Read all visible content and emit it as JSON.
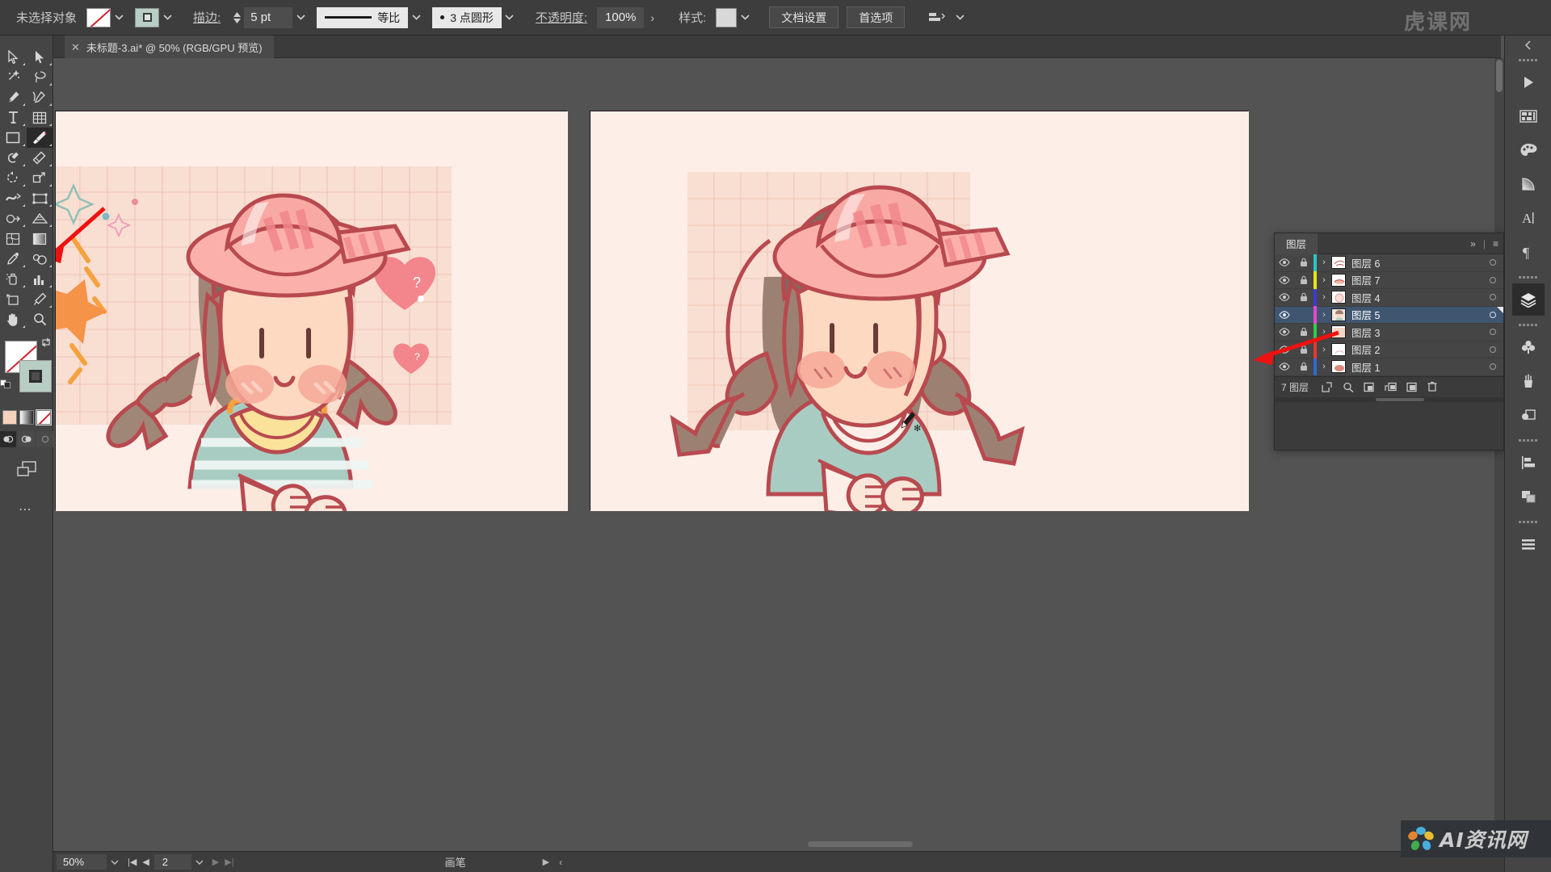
{
  "app": {
    "name": "Adobe Illustrator",
    "selection_status": "未选择对象"
  },
  "control_bar": {
    "fill_label": "fill-swatch",
    "stroke_label": "stroke-swatch",
    "stroke_text": "描边:",
    "stroke_weight": "5 pt",
    "stroke_profile": "等比",
    "brush_definition": "3 点圆形",
    "opacity_text": "不透明度:",
    "opacity_value": "100%",
    "style_text": "样式:",
    "document_setup": "文档设置",
    "preferences": "首选项",
    "align_icon": "align-icon"
  },
  "tab_bar": {
    "close_glyph": "✕",
    "document_title": "未标题-3.ai* @ 50% (RGB/GPU 预览)"
  },
  "left_toolbar": {
    "tools": [
      {
        "name": "selection-tool",
        "glyph": "select"
      },
      {
        "name": "direct-selection-tool",
        "glyph": "direct-select"
      },
      {
        "name": "magic-wand-tool",
        "glyph": "wand"
      },
      {
        "name": "lasso-tool",
        "glyph": "lasso"
      },
      {
        "name": "pen-tool",
        "glyph": "pen"
      },
      {
        "name": "curvature-tool",
        "glyph": "curvature"
      },
      {
        "name": "type-tool",
        "glyph": "type"
      },
      {
        "name": "table-tool",
        "glyph": "table"
      },
      {
        "name": "rectangle-tool",
        "glyph": "rect"
      },
      {
        "name": "paintbrush-tool",
        "glyph": "brush"
      },
      {
        "name": "shaper-tool",
        "glyph": "shaper"
      },
      {
        "name": "eraser-tool",
        "glyph": "eraser"
      },
      {
        "name": "rotate-tool",
        "glyph": "rotate"
      },
      {
        "name": "scale-tool",
        "glyph": "scale"
      },
      {
        "name": "width-tool",
        "glyph": "width"
      },
      {
        "name": "free-transform-tool",
        "glyph": "freetransform"
      },
      {
        "name": "shape-builder-tool",
        "glyph": "shapebuilder"
      },
      {
        "name": "perspective-grid-tool",
        "glyph": "perspective"
      },
      {
        "name": "mesh-tool",
        "glyph": "mesh"
      },
      {
        "name": "gradient-tool",
        "glyph": "gradient"
      },
      {
        "name": "eyedropper-tool",
        "glyph": "eyedropper"
      },
      {
        "name": "blend-tool",
        "glyph": "blend"
      },
      {
        "name": "symbol-sprayer-tool",
        "glyph": "sprayer"
      },
      {
        "name": "column-graph-tool",
        "glyph": "graph"
      },
      {
        "name": "artboard-tool",
        "glyph": "artboard"
      },
      {
        "name": "slice-tool",
        "glyph": "slice"
      },
      {
        "name": "hand-tool",
        "glyph": "hand"
      },
      {
        "name": "zoom-tool",
        "glyph": "zoom"
      }
    ],
    "selected_tool": "paintbrush-tool",
    "fill_color": "#ffffff",
    "fill_is_none": true,
    "stroke_color": "#b8cdc4",
    "mini_swatches": [
      "#f6d2bd",
      "gradient",
      "none"
    ],
    "draw_modes": [
      "draw-normal",
      "draw-behind",
      "draw-inside"
    ],
    "more_tools": "⋯"
  },
  "layers_panel": {
    "title": "图层",
    "collapse_glyph": "»",
    "menu_glyph": "≡",
    "rows": [
      {
        "name": "图层 6",
        "color": "#2ec6c6",
        "visible": true,
        "locked": true,
        "selected": false,
        "thumb": "#f3ded6"
      },
      {
        "name": "图层 7",
        "color": "#e8e413",
        "visible": true,
        "locked": true,
        "selected": false,
        "thumb": "#f6e0d8"
      },
      {
        "name": "图层 4",
        "color": "#3b3bd6",
        "visible": true,
        "locked": true,
        "selected": false,
        "thumb": "#fae6e0"
      },
      {
        "name": "图层 5",
        "color": "#e846c8",
        "visible": true,
        "locked": false,
        "selected": true,
        "thumb": "#e9c3a8"
      },
      {
        "name": "图层 3",
        "color": "#2ecc4a",
        "visible": true,
        "locked": true,
        "selected": false,
        "thumb": "#f6d8c8"
      },
      {
        "name": "图层 2",
        "color": "#e33b2e",
        "visible": true,
        "locked": true,
        "selected": false,
        "thumb": "#ffffff"
      },
      {
        "name": "图层 1",
        "color": "#2e6ad6",
        "visible": true,
        "locked": true,
        "selected": false,
        "thumb": "#f3d9cf"
      }
    ],
    "footer_count": "7 图层",
    "footer_icons": [
      "locate-object-icon",
      "search-icon",
      "make-clipping-mask-icon",
      "create-sublayer-icon",
      "create-new-layer-icon",
      "delete-layer-icon"
    ]
  },
  "right_dock": {
    "groups": [
      {
        "items": [
          {
            "name": "properties-panel-icon"
          },
          {
            "name": "libraries-panel-icon"
          },
          {
            "name": "color-panel-icon"
          },
          {
            "name": "gradient-panel-icon"
          },
          {
            "name": "character-panel-icon"
          },
          {
            "name": "paragraph-panel-icon"
          }
        ]
      },
      {
        "items": [
          {
            "name": "layers-panel-icon",
            "selected": true
          }
        ]
      },
      {
        "items": [
          {
            "name": "symbols-panel-icon"
          },
          {
            "name": "brushes-panel-icon"
          },
          {
            "name": "transparency-panel-icon"
          }
        ]
      },
      {
        "items": [
          {
            "name": "align-panel-icon"
          },
          {
            "name": "pathfinder-panel-icon"
          }
        ]
      },
      {
        "items": [
          {
            "name": "stroke-panel-icon"
          }
        ]
      }
    ]
  },
  "status_bar": {
    "zoom": "50%",
    "page": "2",
    "tool_name": "画笔",
    "first_glyph": "|◀",
    "prev_glyph": "◀",
    "next_glyph": "▶",
    "last_glyph": "▶|",
    "expand_glyph": "▶",
    "collapse_glyph": "‹"
  },
  "watermarks": {
    "top_right": "虎课网",
    "bottom_right": "AI资讯网"
  },
  "artboards": [
    {
      "id": "artboard-left",
      "background": "#fdeee8",
      "description": "卡通女孩插画 - 带草帽、双麻花辫、条纹上衣，背景有格纸、爱心、星星与闪光装饰"
    },
    {
      "id": "artboard-right",
      "background": "#fdeee8",
      "description": "卡通女孩插画 - 带草帽、双麻花辫、纯色上衣，背景有格纸"
    }
  ],
  "colors": {
    "ui_bg": "#535353",
    "panel_bg": "#3b3b3b",
    "toolbar_bg": "#454545",
    "selection_blue": "#3f5570",
    "artwork_skin": "#fcd9c0",
    "artwork_hair": "#9c8173",
    "artwork_hat": "#f8a9a3",
    "artwork_shirt": "#a9ccc2",
    "artwork_outline": "#b84a4f",
    "artwork_blush": "#f4a896",
    "annotation_red": "#ee1111"
  }
}
